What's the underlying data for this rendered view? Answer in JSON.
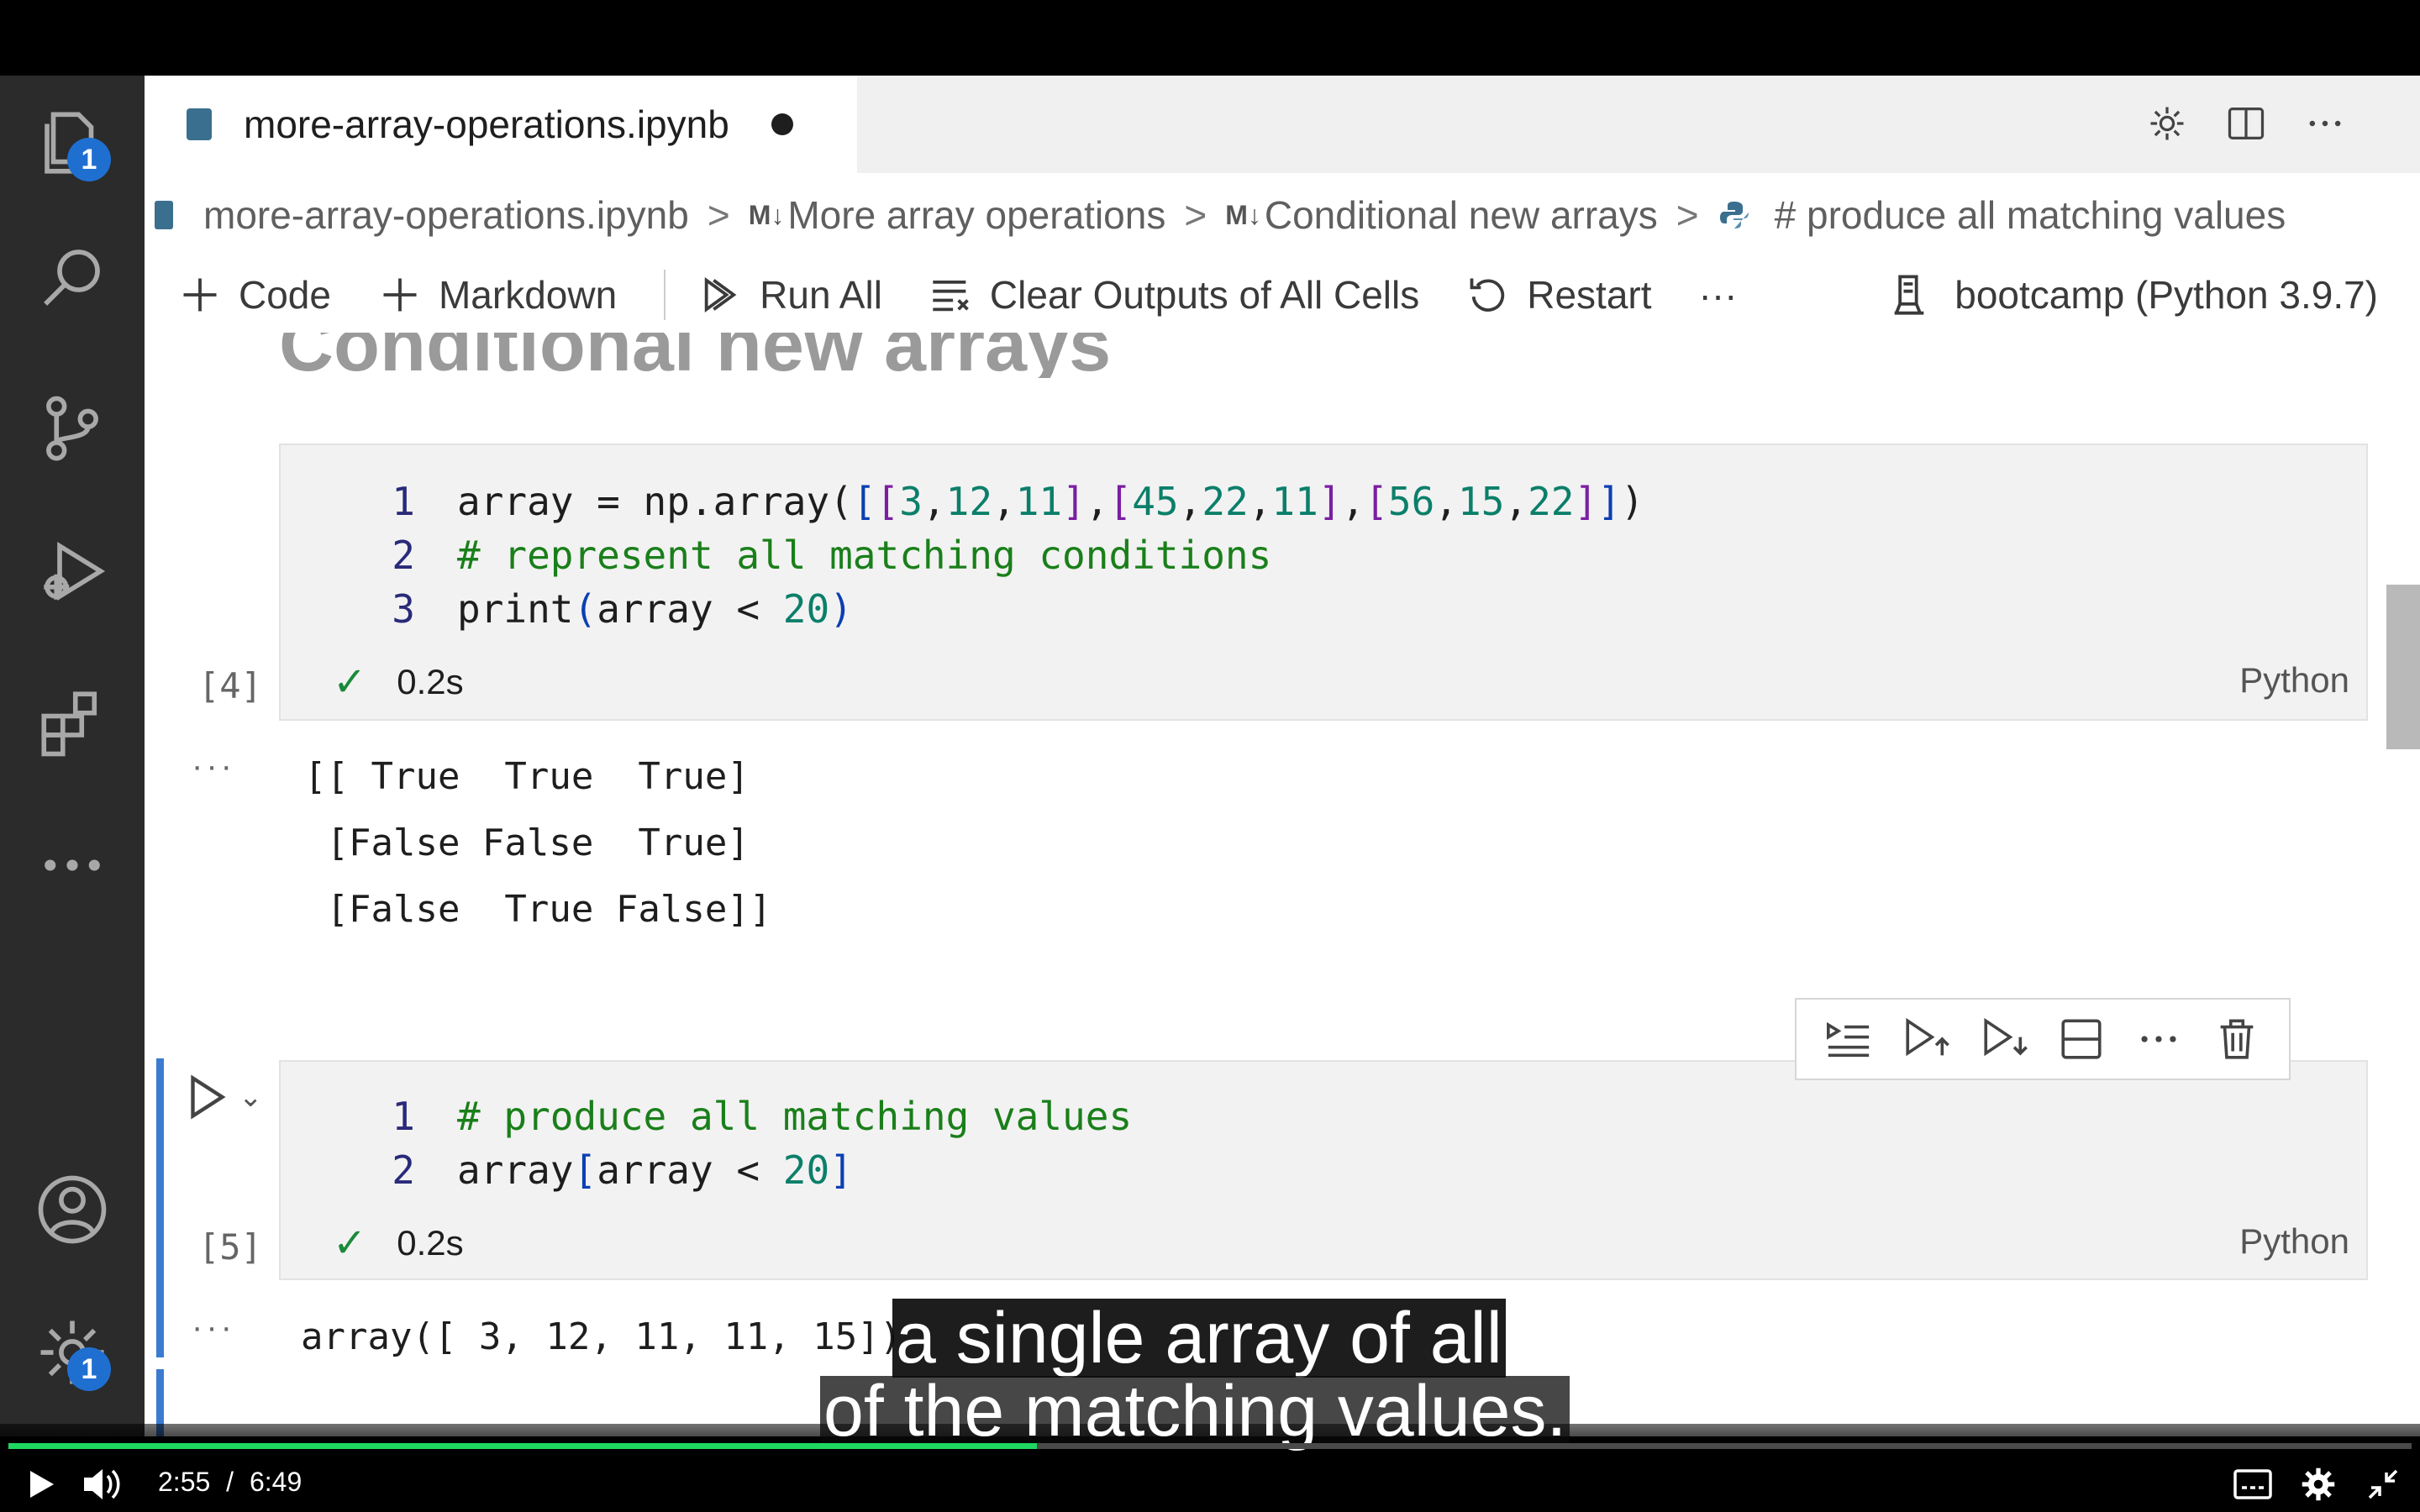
{
  "tab": {
    "title": "more-array-operations.ipynb"
  },
  "activity_bar": {
    "explorer_badge": "1",
    "settings_badge": "1"
  },
  "breadcrumb": {
    "file": "more-array-operations.ipynb",
    "md_marker": "M↓",
    "section1": "More array operations",
    "section2": "Conditional new arrays",
    "cell": "# produce all matching values"
  },
  "toolbar": {
    "code": "Code",
    "markdown": "Markdown",
    "run_all": "Run All",
    "clear_outputs": "Clear Outputs of All Cells",
    "restart": "Restart",
    "more": "···",
    "kernel": "bootcamp (Python 3.9.7)"
  },
  "heading_ghost": "Conditional new arrays",
  "cells": [
    {
      "count": "[4]",
      "line_numbers": [
        "1",
        "2",
        "3"
      ],
      "exec_time": "0.2s",
      "language": "Python",
      "output_dots": "···",
      "output": [
        "[[ True  True  True]",
        " [False False  True]",
        " [False  True False]]"
      ]
    },
    {
      "count": "[5]",
      "line_numbers": [
        "1",
        "2"
      ],
      "exec_time": "0.2s",
      "language": "Python",
      "output_dots": "···",
      "output": [
        "array([ 3, 12, 11, 11, 15])"
      ]
    }
  ],
  "captions": {
    "line1": "a single array of all",
    "line2": "of the matching values."
  },
  "player": {
    "current_time": "2:55",
    "separator": "/",
    "duration": "6:49",
    "progress_fraction": 0.428,
    "accent_color": "#1ed760"
  }
}
